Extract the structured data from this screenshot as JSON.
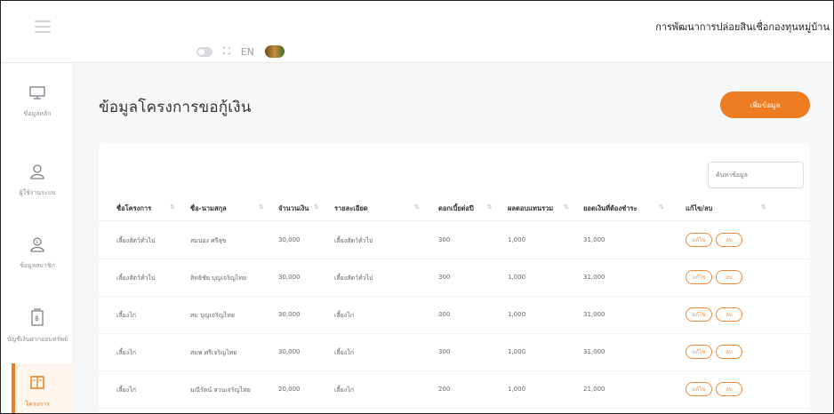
{
  "app": {
    "title": "การพัฒนาการปล่อยสินเชื่อกองทุนหมู่บ้าน"
  },
  "toolbar": {
    "icons": [
      "toggle-switch",
      "fullscreen-icon",
      "language-icon",
      "avatar"
    ],
    "lang_label": "EN"
  },
  "sidebar": {
    "items": [
      {
        "label": "ข้อมูลหลัก",
        "icon": "dashboard-icon"
      },
      {
        "label": "ผู้ใช้งานระบบ",
        "icon": "user-icon"
      },
      {
        "label": "ข้อมูลสมาชิก",
        "icon": "member-icon"
      },
      {
        "label": "บัญชีเงินฝากออมทรัพย์",
        "icon": "savings-icon"
      },
      {
        "label": "โครงการ",
        "icon": "book-icon"
      }
    ]
  },
  "page": {
    "title": "ข้อมูลโครงการขอกู้เงิน",
    "add_button": "เพิ่มข้อมูล",
    "search_placeholder": "ค้นหาข้อมูล"
  },
  "table": {
    "columns": [
      "ชื่อโครงการ",
      "ชื่อ-นามสกุล",
      "จำนวนเงิน",
      "รายละเอียด",
      "ดอกเบี้ยต่อปี",
      "ผลตอบแทนรวม",
      "ยอดเงินที่ต้องชำระ",
      "แก้ไข/ลบ"
    ],
    "rows": [
      {
        "project": "เลี้ยงสัตว์ทั่วไป",
        "name": "สมปอง ศรีสุข",
        "amount": "30,000",
        "detail": "เลี้ยงสัตว์ทั่วไป",
        "interest": "300",
        "return": "1,000",
        "total": "31,000"
      },
      {
        "project": "เลี้ยงสัตว์ทั่วไป",
        "name": "สิทธิชัย บุญเจริญไทย",
        "amount": "30,000",
        "detail": "เลี้ยงสัตว์ทั่วไป",
        "interest": "300",
        "return": "1,000",
        "total": "31,000"
      },
      {
        "project": "เลี้ยงไก่",
        "name": "สม บุญเจริญไทย",
        "amount": "30,000",
        "detail": "เลี้ยงไก่",
        "interest": "300",
        "return": "1,000",
        "total": "31,000"
      },
      {
        "project": "เลี้ยงไก่",
        "name": "สมพ ศรีเจริญไทย",
        "amount": "30,000",
        "detail": "เลี้ยงไก่",
        "interest": "300",
        "return": "1,000",
        "total": "31,000"
      },
      {
        "project": "เลี้ยงไก่",
        "name": "มณีรัตน์ สวนเจริญไทย",
        "amount": "20,000",
        "detail": "เลี้ยงไก่",
        "interest": "200",
        "return": "1,000",
        "total": "21,000"
      }
    ],
    "edit_label": "แก้ไข",
    "delete_label": "ลบ"
  },
  "colors": {
    "accent": "#EE7D22",
    "background": "#F6F7F9"
  }
}
